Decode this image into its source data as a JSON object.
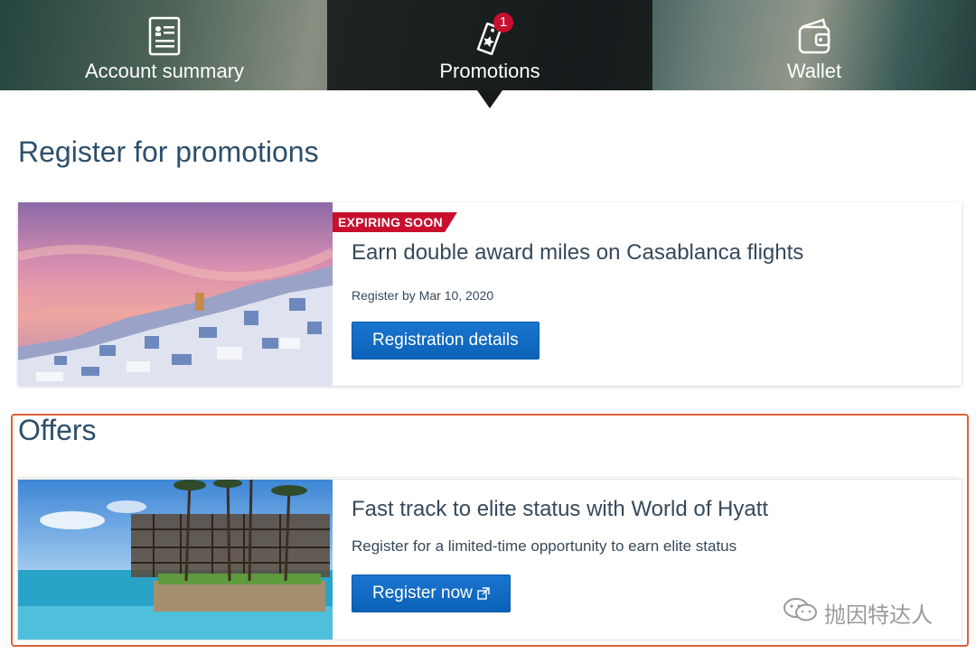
{
  "tabs": [
    {
      "label": "Account summary",
      "icon": "document-icon"
    },
    {
      "label": "Promotions",
      "icon": "tag-icon",
      "badge": "1"
    },
    {
      "label": "Wallet",
      "icon": "wallet-icon"
    }
  ],
  "register": {
    "heading": "Register for promotions",
    "card": {
      "tag": "EXPIRING SOON",
      "title": "Earn double award miles on Casablanca flights",
      "deadline": "Register by Mar 10, 2020",
      "button": "Registration details"
    }
  },
  "offers": {
    "heading": "Offers",
    "card": {
      "title": "Fast track to elite status with World of Hyatt",
      "description": "Register for a limited-time opportunity to earn elite status",
      "button": "Register now"
    }
  },
  "watermark": "抛因特达人",
  "colors": {
    "accent_button": "#0d6cc9",
    "tag_red": "#c8102e",
    "heading": "#2d4f6b",
    "highlight_border": "#e0603a"
  }
}
